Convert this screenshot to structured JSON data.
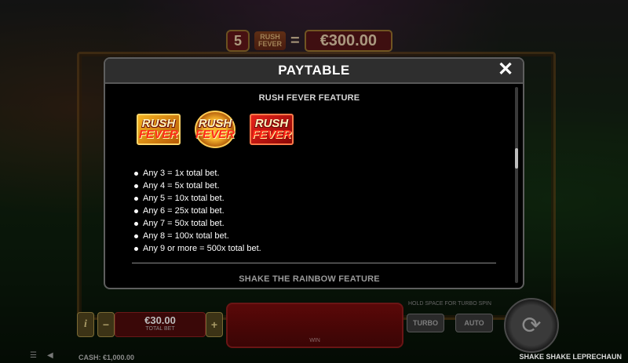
{
  "top": {
    "lines": "5",
    "logo_line1": "RUSH",
    "logo_line2": "FEVER",
    "equals": "=",
    "amount": "€300.00"
  },
  "modal": {
    "title": "PAYTABLE",
    "close_glyph": "✕",
    "section1_title": "RUSH FEVER FEATURE",
    "symbols": [
      {
        "line1": "RUSH",
        "line2": "FEVER",
        "style": "gold-square"
      },
      {
        "line1": "RUSH",
        "line2": "FEVER",
        "style": "gold-coin"
      },
      {
        "line1": "RUSH",
        "line2": "FEVER",
        "style": "red-square"
      }
    ],
    "payouts": [
      "Any 3 = 1x total bet.",
      "Any 4 = 5x total bet.",
      "Any 5 = 10x total bet.",
      "Any 6 = 25x total bet.",
      "Any 7 = 50x total bet.",
      "Any 8 = 100x total bet.",
      "Any 9 or more = 500x total bet."
    ],
    "section2_title": "SHAKE THE RAINBOW FEATURE"
  },
  "controls": {
    "info": "i",
    "minus": "−",
    "plus": "+",
    "bet_amount": "€30.00",
    "bet_label": "TOTAL BET",
    "win_label": "WIN",
    "hint": "HOLD SPACE FOR TURBO SPIN",
    "turbo": "TURBO",
    "auto": "AUTO",
    "spin_glyph": "⟳"
  },
  "footer": {
    "menu_glyph": "☰",
    "speaker_glyph": "◀",
    "cash": "CASH: €1,000.00",
    "game_name": "SHAKE SHAKE LEPRECHAUN"
  }
}
